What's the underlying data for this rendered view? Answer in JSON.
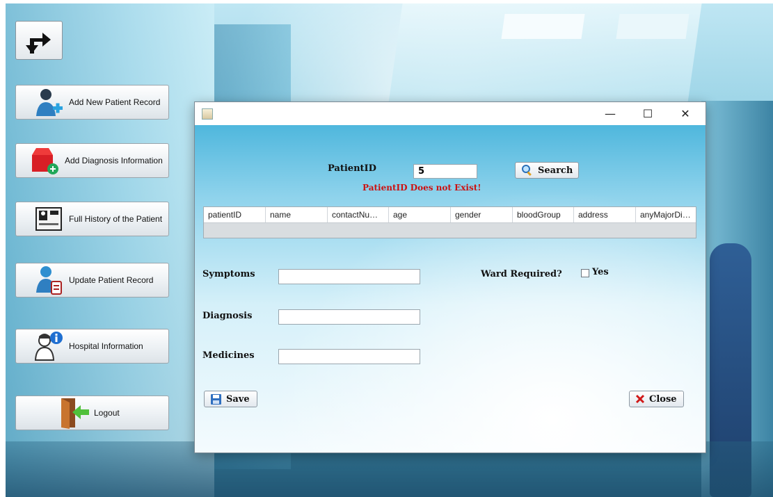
{
  "nav": {
    "items": [
      {
        "label": "Add New Patient Record",
        "icon": "add-patient-icon"
      },
      {
        "label": "Add Diagnosis Information",
        "icon": "add-diagnosis-icon"
      },
      {
        "label": "Full History of the Patient",
        "icon": "patient-history-icon"
      },
      {
        "label": "Update Patient Record",
        "icon": "update-record-icon"
      },
      {
        "label": "Hospital Information",
        "icon": "hospital-info-icon"
      },
      {
        "label": "Logout",
        "icon": "logout-door-icon"
      }
    ]
  },
  "dialog": {
    "controls": {
      "minimize": "—",
      "maximize": "☐",
      "close": "✕"
    },
    "patient_id_label": "PatientID",
    "patient_id_value": "5",
    "search_label": "Search",
    "error": "PatientID Does not Exist!",
    "table": {
      "columns": [
        "patientID",
        "name",
        "contactNumber",
        "age",
        "gender",
        "bloodGroup",
        "address",
        "anyMajorDis..."
      ],
      "rows": []
    },
    "symptoms_label": "Symptoms",
    "diagnosis_label": "Diagnosis",
    "medicines_label": "Medicines",
    "ward_label": "Ward Required?",
    "yes_label": "Yes",
    "save_label": "Save",
    "close_label": "Close"
  },
  "colors": {
    "error": "#cc1111",
    "accent": "#4fb7dd"
  }
}
